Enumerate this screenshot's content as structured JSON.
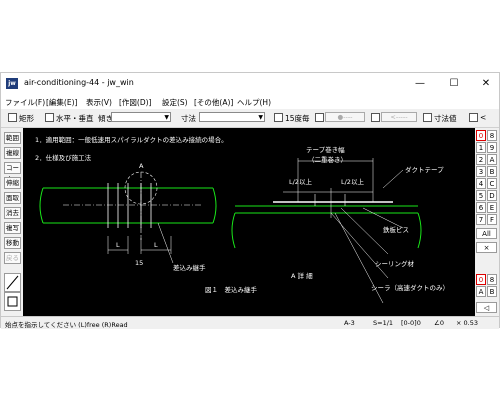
{
  "window": {
    "title": "air-conditioning-44 - jw_win",
    "icon": "jw",
    "controls": [
      "—",
      "☐",
      "✕"
    ]
  },
  "menu": [
    "ファイル(F)",
    "[編集(E)]",
    "表示(V)",
    "[作図(D)]",
    "設定(S)",
    "[その他(A)]",
    "ヘルプ(H)"
  ],
  "toolbar": {
    "rect_label": "矩形",
    "hv_label": "水平・垂直",
    "slope_label": "傾き",
    "dim_label": "寸法",
    "deg15_label": "15度毎",
    "btn1_label": "●----",
    "btn2_label": "<-----",
    "dimval_label": "寸法値",
    "lt_label": "<"
  },
  "left_tools": [
    "範囲",
    "複線",
    "コーナー",
    "伸縮",
    "面取",
    "消去",
    "複写",
    "移動",
    "戻る"
  ],
  "right_tools": {
    "left_col": [
      "0",
      "1",
      "2",
      "3",
      "4",
      "5",
      "6",
      "7",
      "All",
      "×",
      "0",
      "A"
    ],
    "right_col": [
      "8",
      "9",
      "A",
      "B",
      "C",
      "D",
      "E",
      "F",
      "8",
      "B"
    ],
    "zoom": "◁"
  },
  "drawing": {
    "line1": "1．適用範囲：一般低速用スパイラルダクトの差込み接続の場合。",
    "line2": "2．仕様及び施工法",
    "label_A": "A",
    "label_L1": "L",
    "label_L2": "L",
    "label_15": "15",
    "label_socket": "差込み継手",
    "fig_caption": "図１　差込み継手",
    "tape_width": "テープ巻き幅",
    "tape_wrap": "（二重巻き）",
    "half_left": "L/2以上",
    "half_right": "L/2以上",
    "duct_tape": "ダクトテープ",
    "screw": "鉄板ビス",
    "sealing": "シーリング材",
    "sealer": "シーラ（高速ダクトのみ）",
    "detail_caption": "A 詳 細"
  },
  "status": {
    "message": "始点を指示してください (L)free (R)Read",
    "sheet": "A-3",
    "scale": "S=1/1",
    "layer": "[0-0]0",
    "angle": "∠0",
    "zoom": "× 0.53"
  }
}
